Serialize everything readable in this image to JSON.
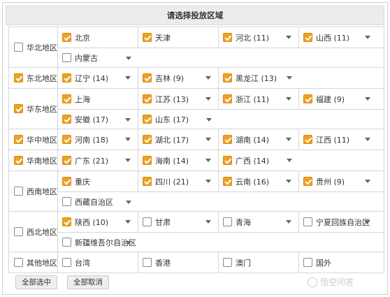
{
  "title": "请选择投放区域",
  "colors": {
    "accent": "#f0a022",
    "border": "#d6d6d6",
    "header_bg": "#ececec"
  },
  "regions": [
    {
      "name": "华北地区",
      "checked": false,
      "rows": [
        [
          {
            "name": "北京",
            "checked": true,
            "dropdown": false
          },
          {
            "name": "天津",
            "checked": true,
            "dropdown": false
          },
          {
            "name": "河北 (11)",
            "checked": true,
            "dropdown": true
          },
          {
            "name": "山西 (11)",
            "checked": true,
            "dropdown": true
          }
        ],
        [
          {
            "name": "内蒙古",
            "checked": false,
            "dropdown": true
          }
        ]
      ]
    },
    {
      "name": "东北地区",
      "checked": true,
      "rows": [
        [
          {
            "name": "辽宁 (14)",
            "checked": true,
            "dropdown": true
          },
          {
            "name": "吉林 (9)",
            "checked": true,
            "dropdown": true
          },
          {
            "name": "黑龙江 (13)",
            "checked": true,
            "dropdown": true
          }
        ]
      ]
    },
    {
      "name": "华东地区",
      "checked": true,
      "rows": [
        [
          {
            "name": "上海",
            "checked": true,
            "dropdown": false
          },
          {
            "name": "江苏 (13)",
            "checked": true,
            "dropdown": true
          },
          {
            "name": "浙江 (11)",
            "checked": true,
            "dropdown": true
          },
          {
            "name": "福建 (9)",
            "checked": true,
            "dropdown": true
          }
        ],
        [
          {
            "name": "安徽 (17)",
            "checked": true,
            "dropdown": true
          },
          {
            "name": "山东 (17)",
            "checked": true,
            "dropdown": true
          }
        ]
      ]
    },
    {
      "name": "华中地区",
      "checked": true,
      "rows": [
        [
          {
            "name": "河南 (18)",
            "checked": true,
            "dropdown": true
          },
          {
            "name": "湖北 (17)",
            "checked": true,
            "dropdown": true
          },
          {
            "name": "湖南 (14)",
            "checked": true,
            "dropdown": true
          },
          {
            "name": "江西 (11)",
            "checked": true,
            "dropdown": true
          }
        ]
      ]
    },
    {
      "name": "华南地区",
      "checked": true,
      "rows": [
        [
          {
            "name": "广东 (21)",
            "checked": true,
            "dropdown": true
          },
          {
            "name": "海南 (14)",
            "checked": true,
            "dropdown": true
          },
          {
            "name": "广西 (14)",
            "checked": true,
            "dropdown": true
          }
        ]
      ]
    },
    {
      "name": "西南地区",
      "checked": false,
      "rows": [
        [
          {
            "name": "重庆",
            "checked": true,
            "dropdown": false
          },
          {
            "name": "四川 (21)",
            "checked": true,
            "dropdown": true
          },
          {
            "name": "云南 (16)",
            "checked": true,
            "dropdown": true
          },
          {
            "name": "贵州 (9)",
            "checked": true,
            "dropdown": true
          }
        ],
        [
          {
            "name": "西藏自治区",
            "checked": false,
            "dropdown": true
          }
        ]
      ]
    },
    {
      "name": "西北地区",
      "checked": false,
      "rows": [
        [
          {
            "name": "陕西 (10)",
            "checked": true,
            "dropdown": true
          },
          {
            "name": "甘肃",
            "checked": false,
            "dropdown": true
          },
          {
            "name": "青海",
            "checked": false,
            "dropdown": true
          },
          {
            "name": "宁夏回族自治区",
            "checked": false,
            "dropdown": true
          }
        ],
        [
          {
            "name": "新疆维吾尔自治区",
            "checked": false,
            "dropdown": true
          }
        ]
      ]
    },
    {
      "name": "其他地区",
      "checked": false,
      "rows": [
        [
          {
            "name": "台湾",
            "checked": false,
            "dropdown": false
          },
          {
            "name": "香港",
            "checked": false,
            "dropdown": false
          },
          {
            "name": "澳门",
            "checked": false,
            "dropdown": false
          },
          {
            "name": "国外",
            "checked": false,
            "dropdown": false
          }
        ]
      ]
    }
  ],
  "buttons": {
    "select_all": "全部选中",
    "deselect_all": "全部取消"
  },
  "watermark": "悟空问答"
}
